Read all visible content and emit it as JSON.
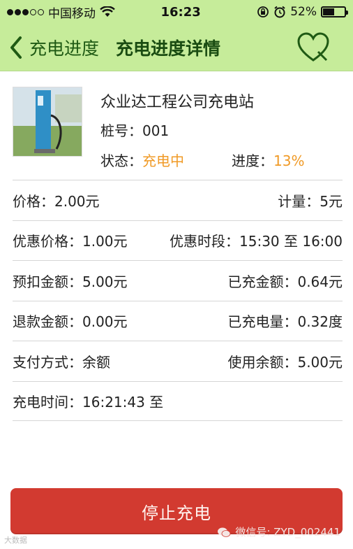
{
  "status_bar": {
    "carrier": "中国移动",
    "time": "16:23",
    "battery": "52%",
    "battery_level": 0.52,
    "signal_filled": 3,
    "signal_total": 5,
    "icons": [
      "wifi-icon",
      "orientation-lock-icon",
      "alarm-icon",
      "battery-icon"
    ]
  },
  "nav": {
    "back_label": "充电进度",
    "title": "充电进度详情",
    "favorite_icon": "heart-icon"
  },
  "station": {
    "name": "众业达工程公司充电站",
    "pile_label": "桩号：",
    "pile_value": "001",
    "status_label": "状态：",
    "status_value": "充电中",
    "progress_label": "进度：",
    "progress_value": "13%"
  },
  "details": {
    "price_label": "价格：",
    "price_value": "2.00元",
    "meter_label": "计量：",
    "meter_value": "5元",
    "discount_price_label": "优惠价格：",
    "discount_price_value": "1.00元",
    "discount_period_label": "优惠时段：",
    "discount_period_value": "15:30 至 16:00",
    "prepaid_label": "预扣金额：",
    "prepaid_value": "5.00元",
    "charged_amount_label": "已充金额：",
    "charged_amount_value": "0.64元",
    "refund_label": "退款金额：",
    "refund_value": "0.00元",
    "charged_energy_label": "已充电量：",
    "charged_energy_value": "0.32度",
    "payment_label": "支付方式：",
    "payment_value": "余额",
    "used_balance_label": "使用余额：",
    "used_balance_value": "5.00元",
    "charge_time_label": "充电时间：",
    "charge_time_value": "16:21:43 至"
  },
  "actions": {
    "stop_label": "停止充电"
  },
  "watermark": {
    "text": "微信号: ZYD_002441",
    "corner_text": "大数据"
  },
  "colors": {
    "header_bg": "#c6ec9a",
    "accent_orange": "#f09a26",
    "stop_button": "#d23a30"
  }
}
